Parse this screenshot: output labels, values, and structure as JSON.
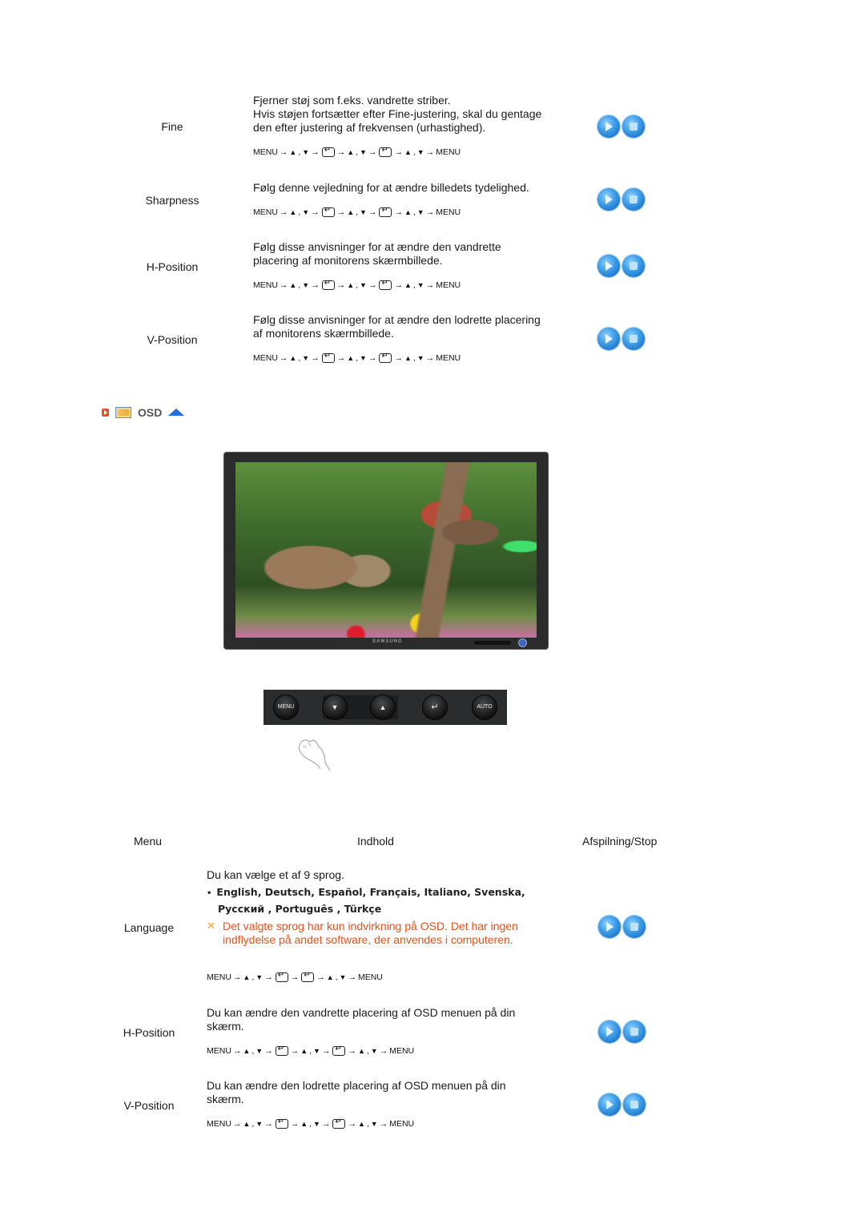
{
  "image_section": {
    "rows": [
      {
        "label": "Fine",
        "description_lines": [
          "Fjerner støj som f.eks. vandrette striber.",
          "Hvis støjen fortsætter efter Fine-justering, skal du gentage",
          "den efter justering af frekvensen (urhastighed)."
        ],
        "sequence": [
          "MENU",
          "→",
          "▲",
          ",",
          "▼",
          "→",
          "ENTER",
          "→",
          "▲",
          ",",
          "▼",
          "→",
          "ENTER",
          "→",
          "▲",
          ",",
          "▼",
          "→",
          "MENU"
        ]
      },
      {
        "label": "Sharpness",
        "description_lines": [
          "Følg denne vejledning for at ændre billedets tydelighed."
        ],
        "sequence": [
          "MENU",
          "→",
          "▲",
          ",",
          "▼",
          "→",
          "ENTER",
          "→",
          "▲",
          ",",
          "▼",
          "→",
          "ENTER",
          "→",
          "▲",
          ",",
          "▼",
          "→",
          "MENU"
        ]
      },
      {
        "label": "H-Position",
        "description_lines": [
          "Følg disse anvisninger for at ændre den vandrette",
          "placering af monitorens skærmbillede."
        ],
        "sequence": [
          "MENU",
          "→",
          "▲",
          ",",
          "▼",
          "→",
          "ENTER",
          "→",
          "▲",
          ",",
          "▼",
          "→",
          "ENTER",
          "→",
          "▲",
          ",",
          "▼",
          "→",
          "MENU"
        ]
      },
      {
        "label": "V-Position",
        "description_lines": [
          "Følg disse anvisninger for at ændre den lodrette placering",
          "af monitorens skærmbillede."
        ],
        "sequence": [
          "MENU",
          "→",
          "▲",
          ",",
          "▼",
          "→",
          "ENTER",
          "→",
          "▲",
          ",",
          "▼",
          "→",
          "ENTER",
          "→",
          "▲",
          ",",
          "▼",
          "→",
          "MENU"
        ]
      }
    ]
  },
  "osd_header": {
    "title": "OSD",
    "icons": [
      "bullet-arrow-icon",
      "picture-icon",
      "up-arrow-icon"
    ]
  },
  "monitor": {
    "brand": "SAMSUNG"
  },
  "control_panel": {
    "buttons": [
      {
        "name": "menu-button",
        "label": "MENU",
        "icon": "menu-icon"
      },
      {
        "name": "down-button",
        "label": "▼",
        "icon": "contrast-down-icon"
      },
      {
        "name": "up-button",
        "label": "▲",
        "icon": "brightness-up-icon"
      },
      {
        "name": "enter-button",
        "label": "↵",
        "icon": "enter-icon"
      },
      {
        "name": "auto-button",
        "label": "AUTO",
        "icon": "auto-icon"
      }
    ]
  },
  "osd_table": {
    "headers": [
      "Menu",
      "Indhold",
      "Afspilning/Stop"
    ],
    "language": {
      "label": "Language",
      "intro": "Du kan vælge et af 9 sprog.",
      "languages_line1": "English, Deutsch, Español, Français,  Italiano, Svenska,",
      "languages_line2": "Русский , Português , Türkçe",
      "note_line1": "Det valgte sprog har kun indvirkning på OSD. Det har ingen",
      "note_line2": "indflydelse på andet software, der anvendes i computeren.",
      "sequence": [
        "MENU",
        "→",
        "▲",
        ",",
        "▼",
        "→",
        "ENTER",
        "→",
        "ENTER",
        "→",
        "▲",
        ",",
        "▼",
        "→",
        "MENU"
      ]
    },
    "rows": [
      {
        "label": "H-Position",
        "description_lines": [
          "Du kan ændre den vandrette placering af OSD menuen på din",
          "skærm."
        ],
        "sequence": [
          "MENU",
          "→",
          "▲",
          ",",
          "▼",
          "→",
          "ENTER",
          "→",
          "▲",
          ",",
          "▼",
          "→",
          "ENTER",
          "→",
          "▲",
          ",",
          "▼",
          "→",
          "MENU"
        ]
      },
      {
        "label": "V-Position",
        "description_lines": [
          "Du kan ændre den lodrette placering af OSD menuen på din",
          "skærm."
        ],
        "sequence": [
          "MENU",
          "→",
          "▲",
          ",",
          "▼",
          "→",
          "ENTER",
          "→",
          "▲",
          ",",
          "▼",
          "→",
          "ENTER",
          "→",
          "▲",
          ",",
          "▼",
          "→",
          "MENU"
        ]
      }
    ]
  },
  "colors": {
    "accent_blue": "#2a8be0",
    "note_orange": "#e8501a",
    "header_gray": "#555555"
  }
}
